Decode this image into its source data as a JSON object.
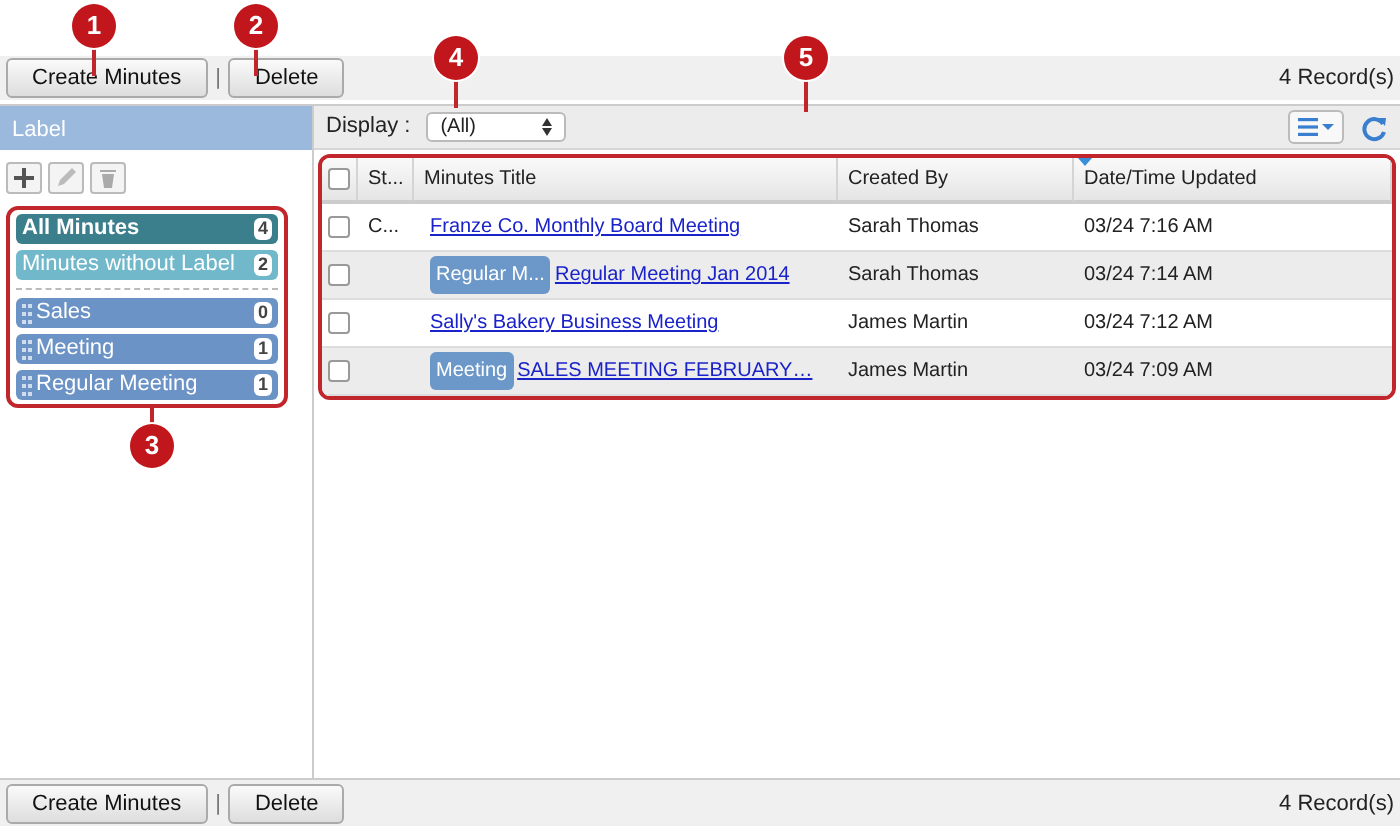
{
  "callouts": [
    "1",
    "2",
    "3",
    "4",
    "5"
  ],
  "top_toolbar": {
    "buttons": [
      "Create Minutes",
      "Delete"
    ],
    "separator": "|",
    "records": "4 Record(s)"
  },
  "label_panel": {
    "title": "Label",
    "items": [
      {
        "name": "All Minutes",
        "count": "4",
        "kind": "system",
        "selected": true
      },
      {
        "name": "Minutes without Label",
        "count": "2",
        "kind": "system",
        "selected": false
      },
      {
        "name": "Sales",
        "count": "0",
        "kind": "custom",
        "selected": false
      },
      {
        "name": "Meeting",
        "count": "1",
        "kind": "custom",
        "selected": false
      },
      {
        "name": "Regular Meeting",
        "count": "1",
        "kind": "custom",
        "selected": false
      }
    ]
  },
  "display": {
    "label": "Display :",
    "value": "(All)"
  },
  "table": {
    "columns": [
      {
        "kind": "checkbox",
        "checked": false
      },
      {
        "title": "St...",
        "sorted": false
      },
      {
        "title": "Minutes Title",
        "sorted": false
      },
      {
        "title": "Created By",
        "sorted": false
      },
      {
        "title": "Date/Time Updated",
        "sorted": true
      }
    ],
    "rows": [
      {
        "checked": false,
        "status": "C...",
        "title": "Franze Co. Monthly Board Meeting",
        "created_by": "Sarah Thomas",
        "updated": "03/24 7:16 AM"
      },
      {
        "checked": false,
        "tag": "Regular M...",
        "title": "Regular Meeting Jan 2014",
        "created_by": "Sarah Thomas",
        "updated": "03/24 7:14 AM"
      },
      {
        "checked": false,
        "title": "Sally's Bakery Business Meeting",
        "created_by": "James Martin",
        "updated": "03/24 7:12 AM"
      },
      {
        "checked": false,
        "tag": "Meeting",
        "title": "SALES MEETING FEBRUARY…",
        "created_by": "James Martin",
        "updated": "03/24 7:09 AM"
      }
    ]
  },
  "bottom_toolbar": {
    "buttons": [
      "Create Minutes",
      "Delete"
    ],
    "separator": "|",
    "records": "4 Record(s)"
  }
}
